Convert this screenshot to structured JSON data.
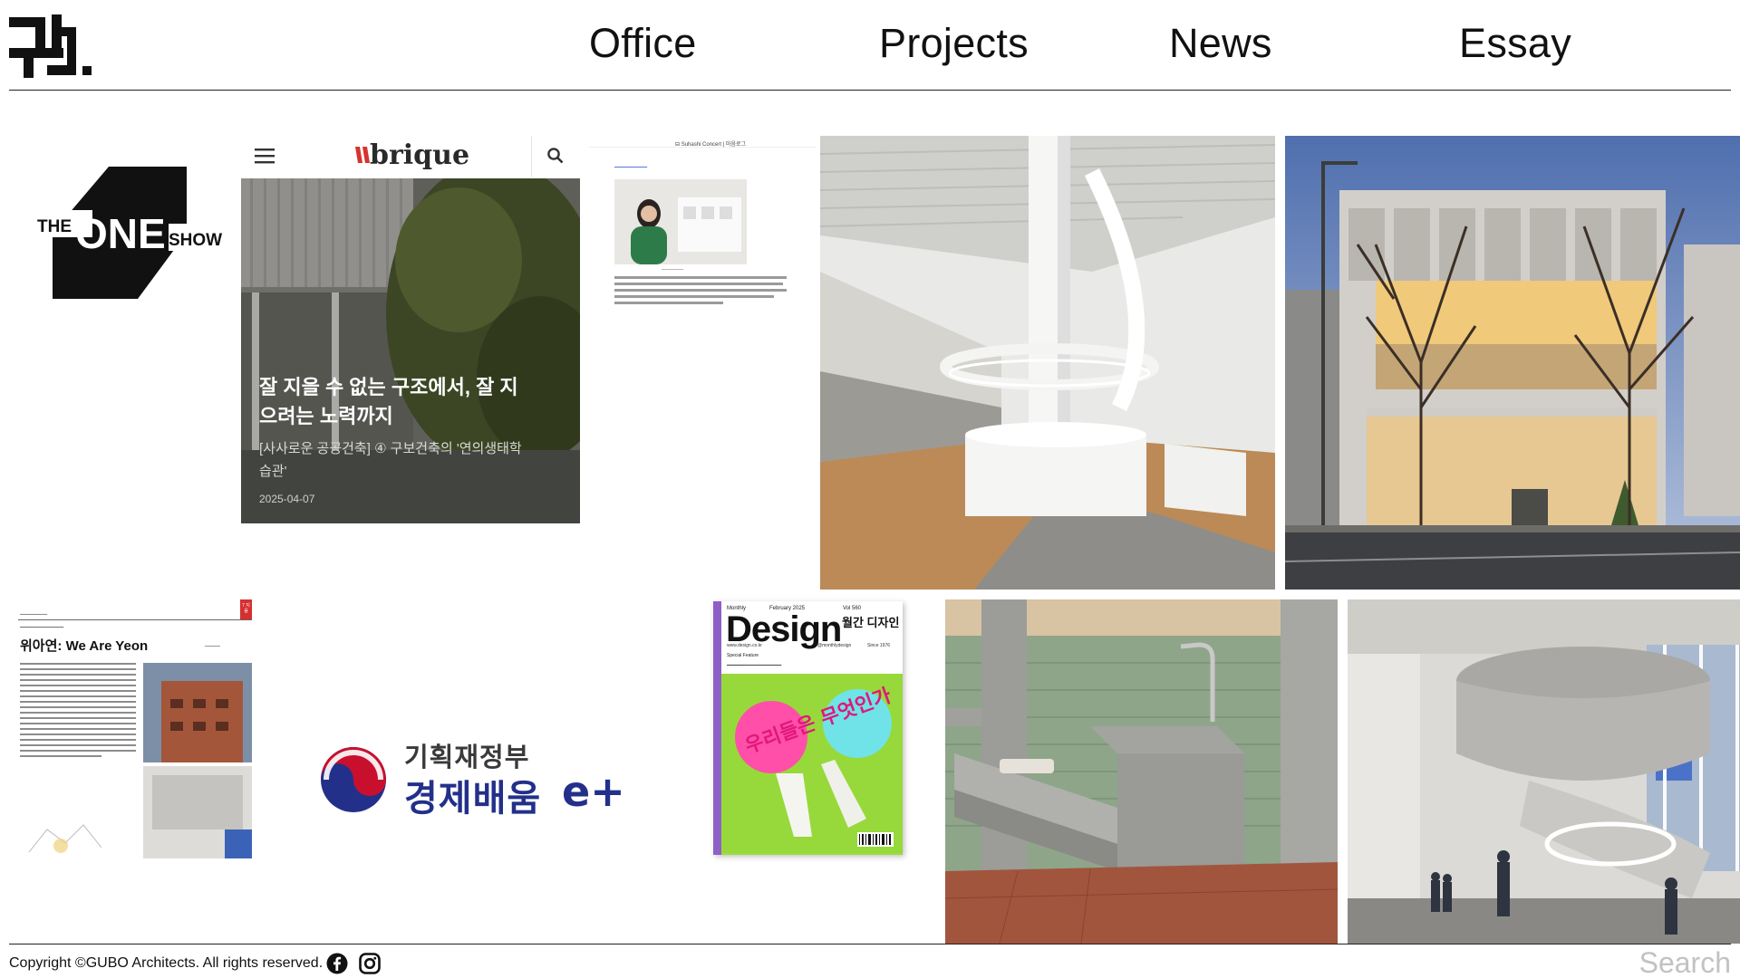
{
  "nav": {
    "items": [
      {
        "label": "Office"
      },
      {
        "label": "Projects"
      },
      {
        "label": "News"
      },
      {
        "label": "Essay"
      }
    ]
  },
  "tiles": {
    "one_show": {
      "prefix": "THE",
      "main": "ONE",
      "suffix": "SHOW"
    },
    "brique": {
      "logo": "brique",
      "title": "잘 지을 수 없는 구조에서, 잘 지으려는 노력까지",
      "subtitle": "[사사로운 공공건축] ④ 구보건축의 '연의생태학습관'",
      "date": "2025-04-07"
    },
    "article_scan": {
      "header": "⊟ Suhashi Concert | 마음로그"
    },
    "magazine_page": {
      "tab": "7 지음",
      "title": "위아연: We Are Yeon"
    },
    "ministry": {
      "top": "기획재정부",
      "main": "경제배움",
      "mark": "e+"
    },
    "design_cover": {
      "monthly": "Monthly",
      "issue_date": "February 2025",
      "volume": "Vol 560",
      "title": "Design",
      "korean_title": "월간 디자인",
      "url": "www.design.co.kr",
      "handle": "@monthlydesign",
      "since": "Since 1976",
      "special": "Special Feature",
      "art_text": "우리들은 무엇인가"
    }
  },
  "footer": {
    "copyright": "Copyright ©GUBO Architects. All rights reserved.",
    "search_placeholder": "Search"
  },
  "colors": {
    "text": "#111111",
    "rule": "#222222",
    "ministry_blue": "#23308a",
    "ministry_red": "#c8102e",
    "search_gray": "#c2c2c2"
  }
}
